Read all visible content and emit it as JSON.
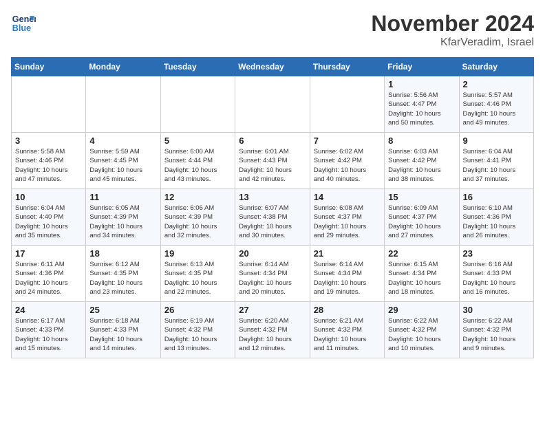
{
  "header": {
    "logo_line1": "General",
    "logo_line2": "Blue",
    "month": "November 2024",
    "location": "KfarVeradim, Israel"
  },
  "weekdays": [
    "Sunday",
    "Monday",
    "Tuesday",
    "Wednesday",
    "Thursday",
    "Friday",
    "Saturday"
  ],
  "weeks": [
    [
      {
        "day": "",
        "info": ""
      },
      {
        "day": "",
        "info": ""
      },
      {
        "day": "",
        "info": ""
      },
      {
        "day": "",
        "info": ""
      },
      {
        "day": "",
        "info": ""
      },
      {
        "day": "1",
        "info": "Sunrise: 5:56 AM\nSunset: 4:47 PM\nDaylight: 10 hours\nand 50 minutes."
      },
      {
        "day": "2",
        "info": "Sunrise: 5:57 AM\nSunset: 4:46 PM\nDaylight: 10 hours\nand 49 minutes."
      }
    ],
    [
      {
        "day": "3",
        "info": "Sunrise: 5:58 AM\nSunset: 4:46 PM\nDaylight: 10 hours\nand 47 minutes."
      },
      {
        "day": "4",
        "info": "Sunrise: 5:59 AM\nSunset: 4:45 PM\nDaylight: 10 hours\nand 45 minutes."
      },
      {
        "day": "5",
        "info": "Sunrise: 6:00 AM\nSunset: 4:44 PM\nDaylight: 10 hours\nand 43 minutes."
      },
      {
        "day": "6",
        "info": "Sunrise: 6:01 AM\nSunset: 4:43 PM\nDaylight: 10 hours\nand 42 minutes."
      },
      {
        "day": "7",
        "info": "Sunrise: 6:02 AM\nSunset: 4:42 PM\nDaylight: 10 hours\nand 40 minutes."
      },
      {
        "day": "8",
        "info": "Sunrise: 6:03 AM\nSunset: 4:42 PM\nDaylight: 10 hours\nand 38 minutes."
      },
      {
        "day": "9",
        "info": "Sunrise: 6:04 AM\nSunset: 4:41 PM\nDaylight: 10 hours\nand 37 minutes."
      }
    ],
    [
      {
        "day": "10",
        "info": "Sunrise: 6:04 AM\nSunset: 4:40 PM\nDaylight: 10 hours\nand 35 minutes."
      },
      {
        "day": "11",
        "info": "Sunrise: 6:05 AM\nSunset: 4:39 PM\nDaylight: 10 hours\nand 34 minutes."
      },
      {
        "day": "12",
        "info": "Sunrise: 6:06 AM\nSunset: 4:39 PM\nDaylight: 10 hours\nand 32 minutes."
      },
      {
        "day": "13",
        "info": "Sunrise: 6:07 AM\nSunset: 4:38 PM\nDaylight: 10 hours\nand 30 minutes."
      },
      {
        "day": "14",
        "info": "Sunrise: 6:08 AM\nSunset: 4:37 PM\nDaylight: 10 hours\nand 29 minutes."
      },
      {
        "day": "15",
        "info": "Sunrise: 6:09 AM\nSunset: 4:37 PM\nDaylight: 10 hours\nand 27 minutes."
      },
      {
        "day": "16",
        "info": "Sunrise: 6:10 AM\nSunset: 4:36 PM\nDaylight: 10 hours\nand 26 minutes."
      }
    ],
    [
      {
        "day": "17",
        "info": "Sunrise: 6:11 AM\nSunset: 4:36 PM\nDaylight: 10 hours\nand 24 minutes."
      },
      {
        "day": "18",
        "info": "Sunrise: 6:12 AM\nSunset: 4:35 PM\nDaylight: 10 hours\nand 23 minutes."
      },
      {
        "day": "19",
        "info": "Sunrise: 6:13 AM\nSunset: 4:35 PM\nDaylight: 10 hours\nand 22 minutes."
      },
      {
        "day": "20",
        "info": "Sunrise: 6:14 AM\nSunset: 4:34 PM\nDaylight: 10 hours\nand 20 minutes."
      },
      {
        "day": "21",
        "info": "Sunrise: 6:14 AM\nSunset: 4:34 PM\nDaylight: 10 hours\nand 19 minutes."
      },
      {
        "day": "22",
        "info": "Sunrise: 6:15 AM\nSunset: 4:34 PM\nDaylight: 10 hours\nand 18 minutes."
      },
      {
        "day": "23",
        "info": "Sunrise: 6:16 AM\nSunset: 4:33 PM\nDaylight: 10 hours\nand 16 minutes."
      }
    ],
    [
      {
        "day": "24",
        "info": "Sunrise: 6:17 AM\nSunset: 4:33 PM\nDaylight: 10 hours\nand 15 minutes."
      },
      {
        "day": "25",
        "info": "Sunrise: 6:18 AM\nSunset: 4:33 PM\nDaylight: 10 hours\nand 14 minutes."
      },
      {
        "day": "26",
        "info": "Sunrise: 6:19 AM\nSunset: 4:32 PM\nDaylight: 10 hours\nand 13 minutes."
      },
      {
        "day": "27",
        "info": "Sunrise: 6:20 AM\nSunset: 4:32 PM\nDaylight: 10 hours\nand 12 minutes."
      },
      {
        "day": "28",
        "info": "Sunrise: 6:21 AM\nSunset: 4:32 PM\nDaylight: 10 hours\nand 11 minutes."
      },
      {
        "day": "29",
        "info": "Sunrise: 6:22 AM\nSunset: 4:32 PM\nDaylight: 10 hours\nand 10 minutes."
      },
      {
        "day": "30",
        "info": "Sunrise: 6:22 AM\nSunset: 4:32 PM\nDaylight: 10 hours\nand 9 minutes."
      }
    ]
  ]
}
